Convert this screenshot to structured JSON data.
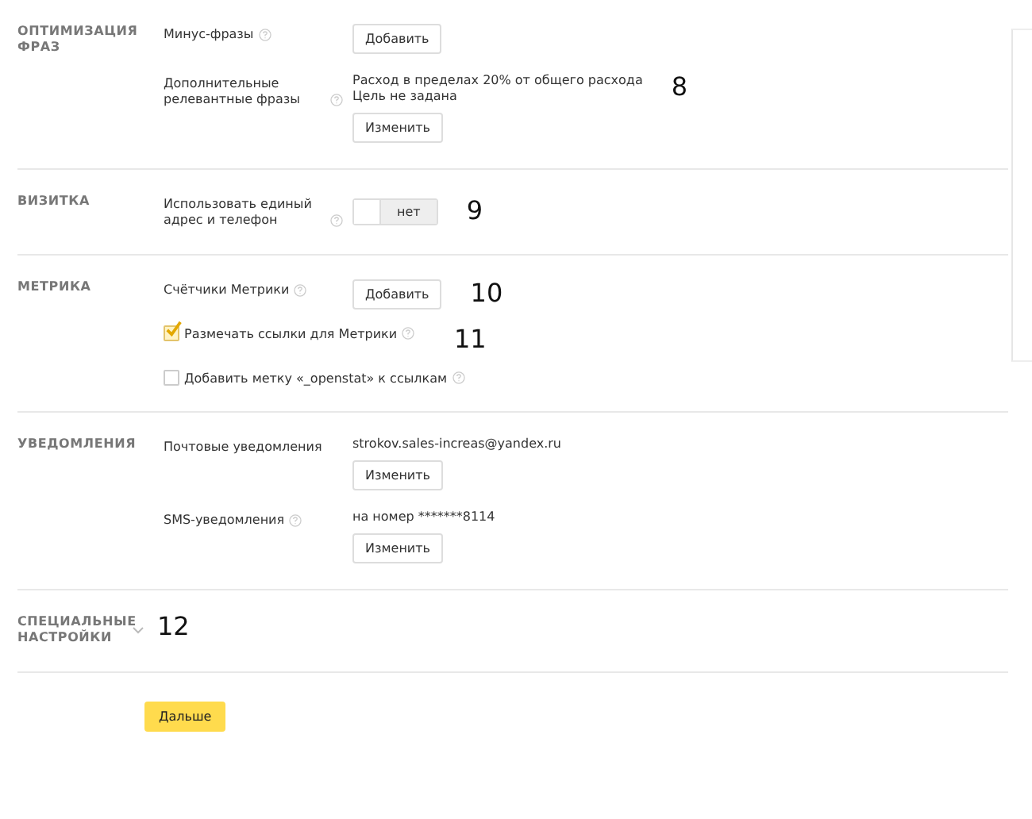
{
  "sections": [
    {
      "title": "ОПТИМИЗАЦИЯ ФРАЗ",
      "rows": [
        {
          "kind": "setting",
          "label": "Минус-фразы",
          "help": true,
          "button": "Добавить"
        },
        {
          "kind": "setting",
          "label": "Дополнительные релевантные фразы",
          "help": true,
          "lines": [
            "Расход в пределах 20% от общего расхода",
            "Цель не задана"
          ],
          "button": "Изменить",
          "annotation": "8"
        }
      ]
    },
    {
      "title": "ВИЗИТКА",
      "rows": [
        {
          "kind": "toggle",
          "label": "Использовать единый адрес и телефон",
          "help": true,
          "toggle": {
            "label": "нет",
            "on": false
          },
          "annotation": "9"
        }
      ]
    },
    {
      "title": "МЕТРИКА",
      "rows": [
        {
          "kind": "setting",
          "label": "Счётчики Метрики",
          "help": true,
          "button": "Добавить",
          "annotation": "10"
        },
        {
          "kind": "checkbox",
          "label": "Размечать ссылки для Метрики",
          "help": true,
          "checked": true,
          "annotation": "11"
        },
        {
          "kind": "checkbox",
          "label": "Добавить метку «_openstat» к ссылкам",
          "help": true,
          "checked": false
        }
      ]
    },
    {
      "title": "УВЕДОМЛЕНИЯ",
      "rows": [
        {
          "kind": "setting",
          "label": "Почтовые уведомления",
          "help": false,
          "lines": [
            "strokov.sales-increas@yandex.ru"
          ],
          "button": "Изменить"
        },
        {
          "kind": "setting",
          "label": "SMS-уведомления",
          "help": true,
          "lines": [
            "на номер *******8114"
          ],
          "button": "Изменить"
        }
      ]
    },
    {
      "title": "СПЕЦИАЛЬНЫЕ НАСТРОЙКИ",
      "expanded": false,
      "annotation": "12"
    }
  ],
  "next_button": "Дальше"
}
